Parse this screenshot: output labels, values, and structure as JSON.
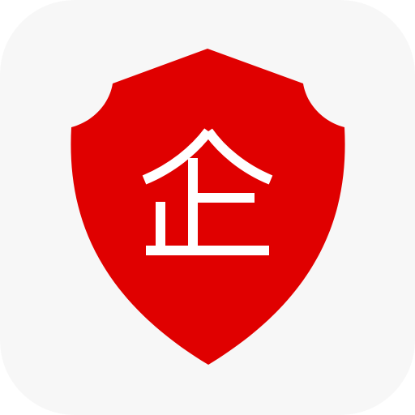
{
  "app_icon": {
    "glyph": "企",
    "background_color": "#f7f7f7",
    "shield_color": "#e00000",
    "glyph_color": "#ffffff"
  }
}
